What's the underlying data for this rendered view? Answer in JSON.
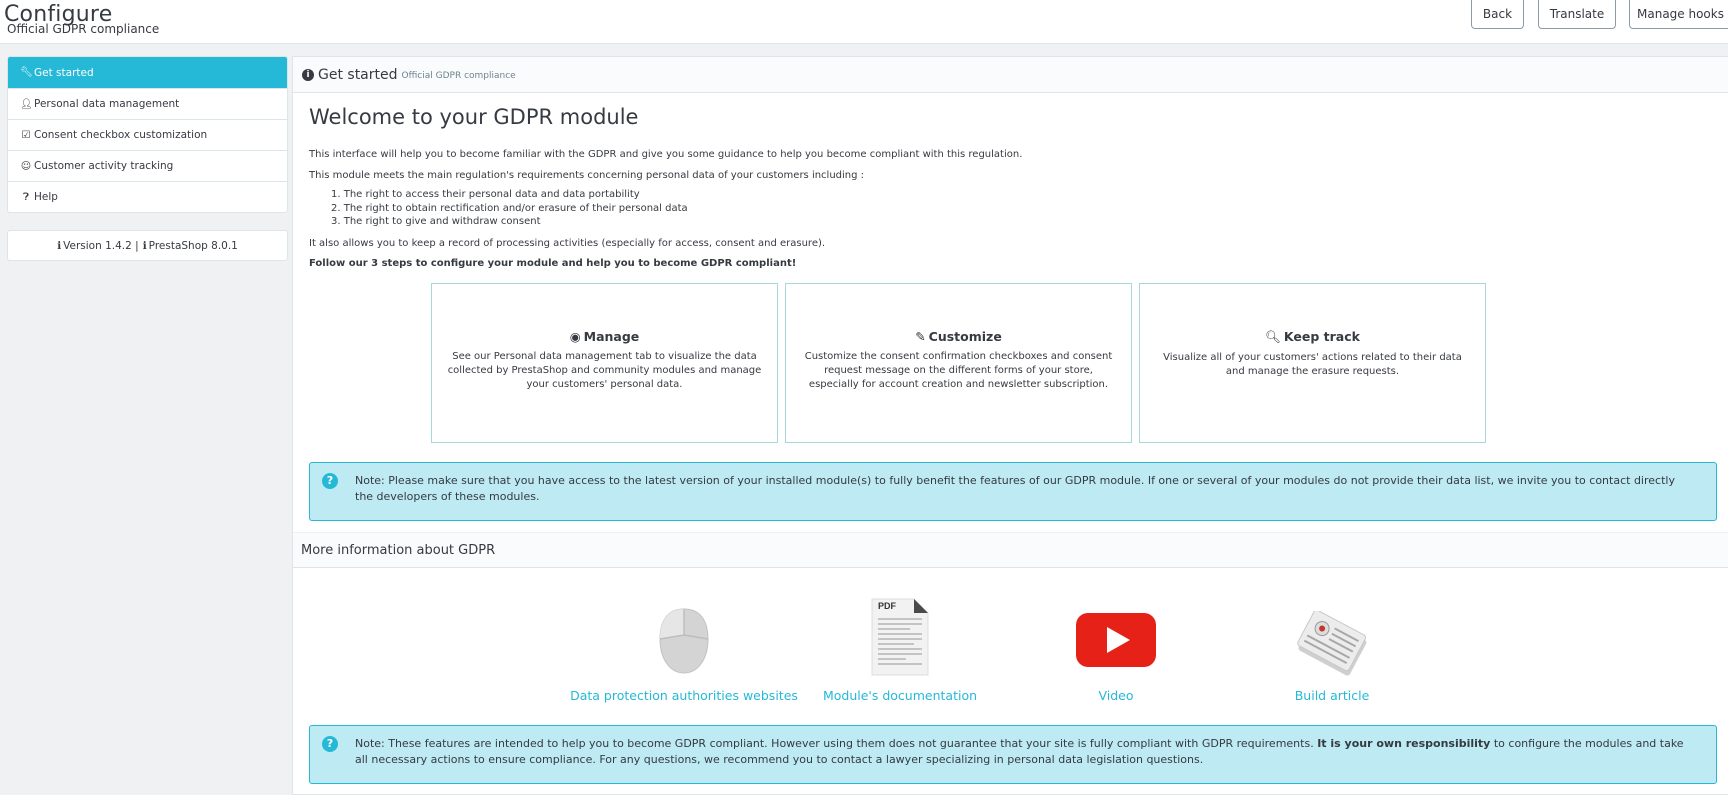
{
  "header": {
    "title": "Configure",
    "subtitle": "Official GDPR compliance",
    "buttons": {
      "back": "Back",
      "translate": "Translate",
      "manage_hooks": "Manage hooks"
    }
  },
  "sidebar": {
    "items": [
      {
        "label": "Get started",
        "icon": "wrench-icon"
      },
      {
        "label": "Personal data management",
        "icon": "user-secret-icon"
      },
      {
        "label": "Consent checkbox customization",
        "icon": "checkbox-icon"
      },
      {
        "label": "Customer activity tracking",
        "icon": "user-circle-icon"
      },
      {
        "label": "Help",
        "icon": "question-circle-icon"
      }
    ],
    "version": "Version 1.4.2 |",
    "prestashop": "PrestaShop 8.0.1"
  },
  "panel": {
    "title": "Get started",
    "subtitle": "Official GDPR compliance",
    "welcome": "Welcome to your GDPR module",
    "intro1": "This interface will help you to become familiar with the GDPR and give you some guidance to help you become compliant with this regulation.",
    "intro2": "This module meets the main regulation's requirements concerning personal data of your customers including :",
    "rights": [
      "1. The right to access their personal data and data portability",
      "2. The right to obtain rectification and/or erasure of their personal data",
      "3. The right to give and withdraw consent"
    ],
    "intro3": "It also allows you to keep a record of processing activities (especially for access, consent and erasure).",
    "steps_title": "Follow our 3 steps to configure your module and help you to become GDPR compliant!",
    "cards": [
      {
        "title": "Manage",
        "icon": "eye-icon",
        "text": "See our Personal data management tab to visualize the data collected by PrestaShop and community modules and manage your customers' personal data."
      },
      {
        "title": "Customize",
        "icon": "pencil-icon",
        "text": "Customize the consent confirmation checkboxes and consent request message on the different forms of your store, especially for account creation and newsletter subscription."
      },
      {
        "title": "Keep track",
        "icon": "search-icon",
        "text": "Visualize all of your customers' actions related to their data and manage the erasure requests."
      }
    ],
    "note1": "Note: Please make sure that you have access to the latest version of your installed module(s) to fully benefit the features of our GDPR module. If one or several of your modules do not provide their data list, we invite you to contact directly the developers of these modules.",
    "more_info_title": "More information about GDPR",
    "resources": [
      {
        "label": "Data protection authorities websites",
        "icon": "mouse-icon"
      },
      {
        "label": "Module's documentation",
        "icon": "pdf-document-icon",
        "badge": "PDF"
      },
      {
        "label": "Video",
        "icon": "youtube-play-icon"
      },
      {
        "label": "Build article",
        "icon": "newspaper-icon"
      }
    ],
    "note2_a": "Note: These features are intended to help you to become GDPR compliant. However using them does not guarantee that your site is fully compliant with GDPR requirements.",
    "note2_bold": "It is your own responsibility",
    "note2_b": "to configure the modules and take all necessary actions to ensure compliance. For any questions, we recommend you to contact a lawyer specializing in personal data legislation questions."
  },
  "colors": {
    "accent": "#25b9d7",
    "alert_bg": "#bdeaf3",
    "youtube_red": "#e62117"
  }
}
